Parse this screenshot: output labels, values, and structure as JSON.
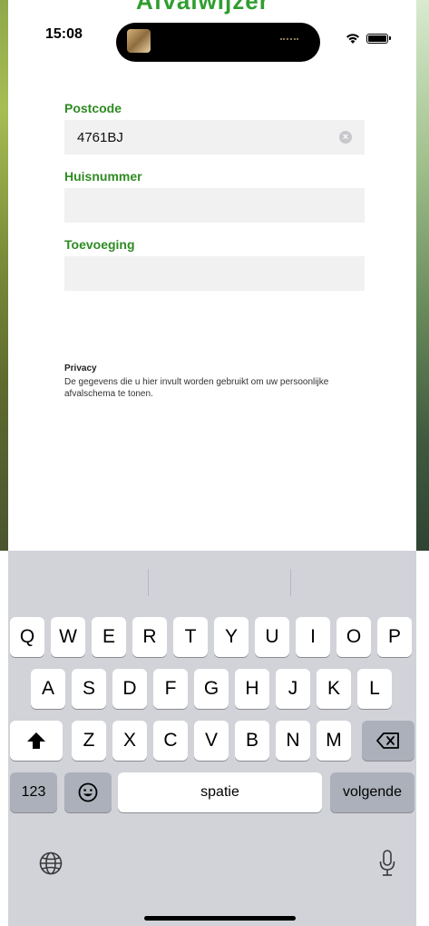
{
  "app": {
    "title": "Afvalwijzer"
  },
  "status_bar": {
    "time": "15:08"
  },
  "form": {
    "postcode": {
      "label": "Postcode",
      "value": "4761BJ"
    },
    "huisnummer": {
      "label": "Huisnummer",
      "value": ""
    },
    "toevoeging": {
      "label": "Toevoeging",
      "value": ""
    }
  },
  "privacy": {
    "title": "Privacy",
    "text": "De gegevens die u hier invult worden gebruikt om uw persoonlijke afvalschema te tonen."
  },
  "keyboard": {
    "row1": [
      "Q",
      "W",
      "E",
      "R",
      "T",
      "Y",
      "U",
      "I",
      "O",
      "P"
    ],
    "row2": [
      "A",
      "S",
      "D",
      "F",
      "G",
      "H",
      "J",
      "K",
      "L"
    ],
    "row3": [
      "Z",
      "X",
      "C",
      "V",
      "B",
      "N",
      "M"
    ],
    "numbers_key": "123",
    "space_key": "spatie",
    "return_key": "volgende"
  },
  "icons": {
    "shift": "shift-icon",
    "delete": "delete-icon",
    "emoji": "emoji-icon",
    "globe": "globe-icon",
    "mic": "microphone-icon",
    "clear": "clear-icon",
    "wifi": "wifi-icon",
    "battery": "battery-icon"
  },
  "colors": {
    "accent_green": "#2e8b22",
    "keyboard_bg": "#d1d3d9"
  }
}
